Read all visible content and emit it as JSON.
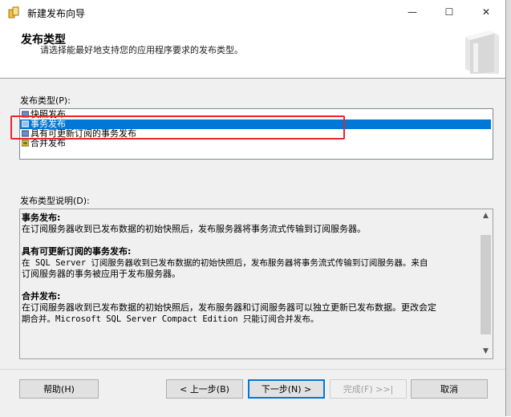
{
  "window": {
    "title": "新建发布向导",
    "minimize_glyph": "—",
    "maximize_glyph": "☐",
    "close_glyph": "✕"
  },
  "header": {
    "title": "发布类型",
    "description": "请选择能最好地支持您的应用程序要求的发布类型。"
  },
  "publication_type": {
    "label": "发布类型(P):",
    "items": [
      {
        "label": "快照发布",
        "icon": "snapshot-publication-icon",
        "selected": false
      },
      {
        "label": "事务发布",
        "icon": "transactional-publication-icon",
        "selected": true
      },
      {
        "label": "具有可更新订阅的事务发布",
        "icon": "updatable-transactional-publication-icon",
        "selected": false
      },
      {
        "label": "合并发布",
        "icon": "merge-publication-icon",
        "selected": false
      }
    ]
  },
  "description": {
    "label": "发布类型说明(D):",
    "sections": [
      {
        "heading": "事务发布:",
        "lines": [
          "在订阅服务器收到已发布数据的初始快照后，发布服务器将事务流式传输到订阅服务器。"
        ]
      },
      {
        "heading": "具有可更新订阅的事务发布:",
        "lines": [
          "在 SQL Server 订阅服务器收到已发布数据的初始快照后，发布服务器将事务流式传输到订阅服务器。来自",
          "订阅服务器的事务被应用于发布服务器。"
        ]
      },
      {
        "heading": "合并发布:",
        "lines": [
          "在订阅服务器收到已发布数据的初始快照后，发布服务器和订阅服务器可以独立更新已发布数据。更改会定",
          "期合并。Microsoft SQL Server Compact Edition 只能订阅合并发布。"
        ]
      }
    ]
  },
  "buttons": {
    "help": "帮助(H)",
    "back": "< 上一步(B)",
    "next": "下一步(N) >",
    "finish": "完成(F) >>|",
    "cancel": "取消"
  },
  "colors": {
    "selection": "#0078d7",
    "highlight_box": "#e8262a"
  }
}
